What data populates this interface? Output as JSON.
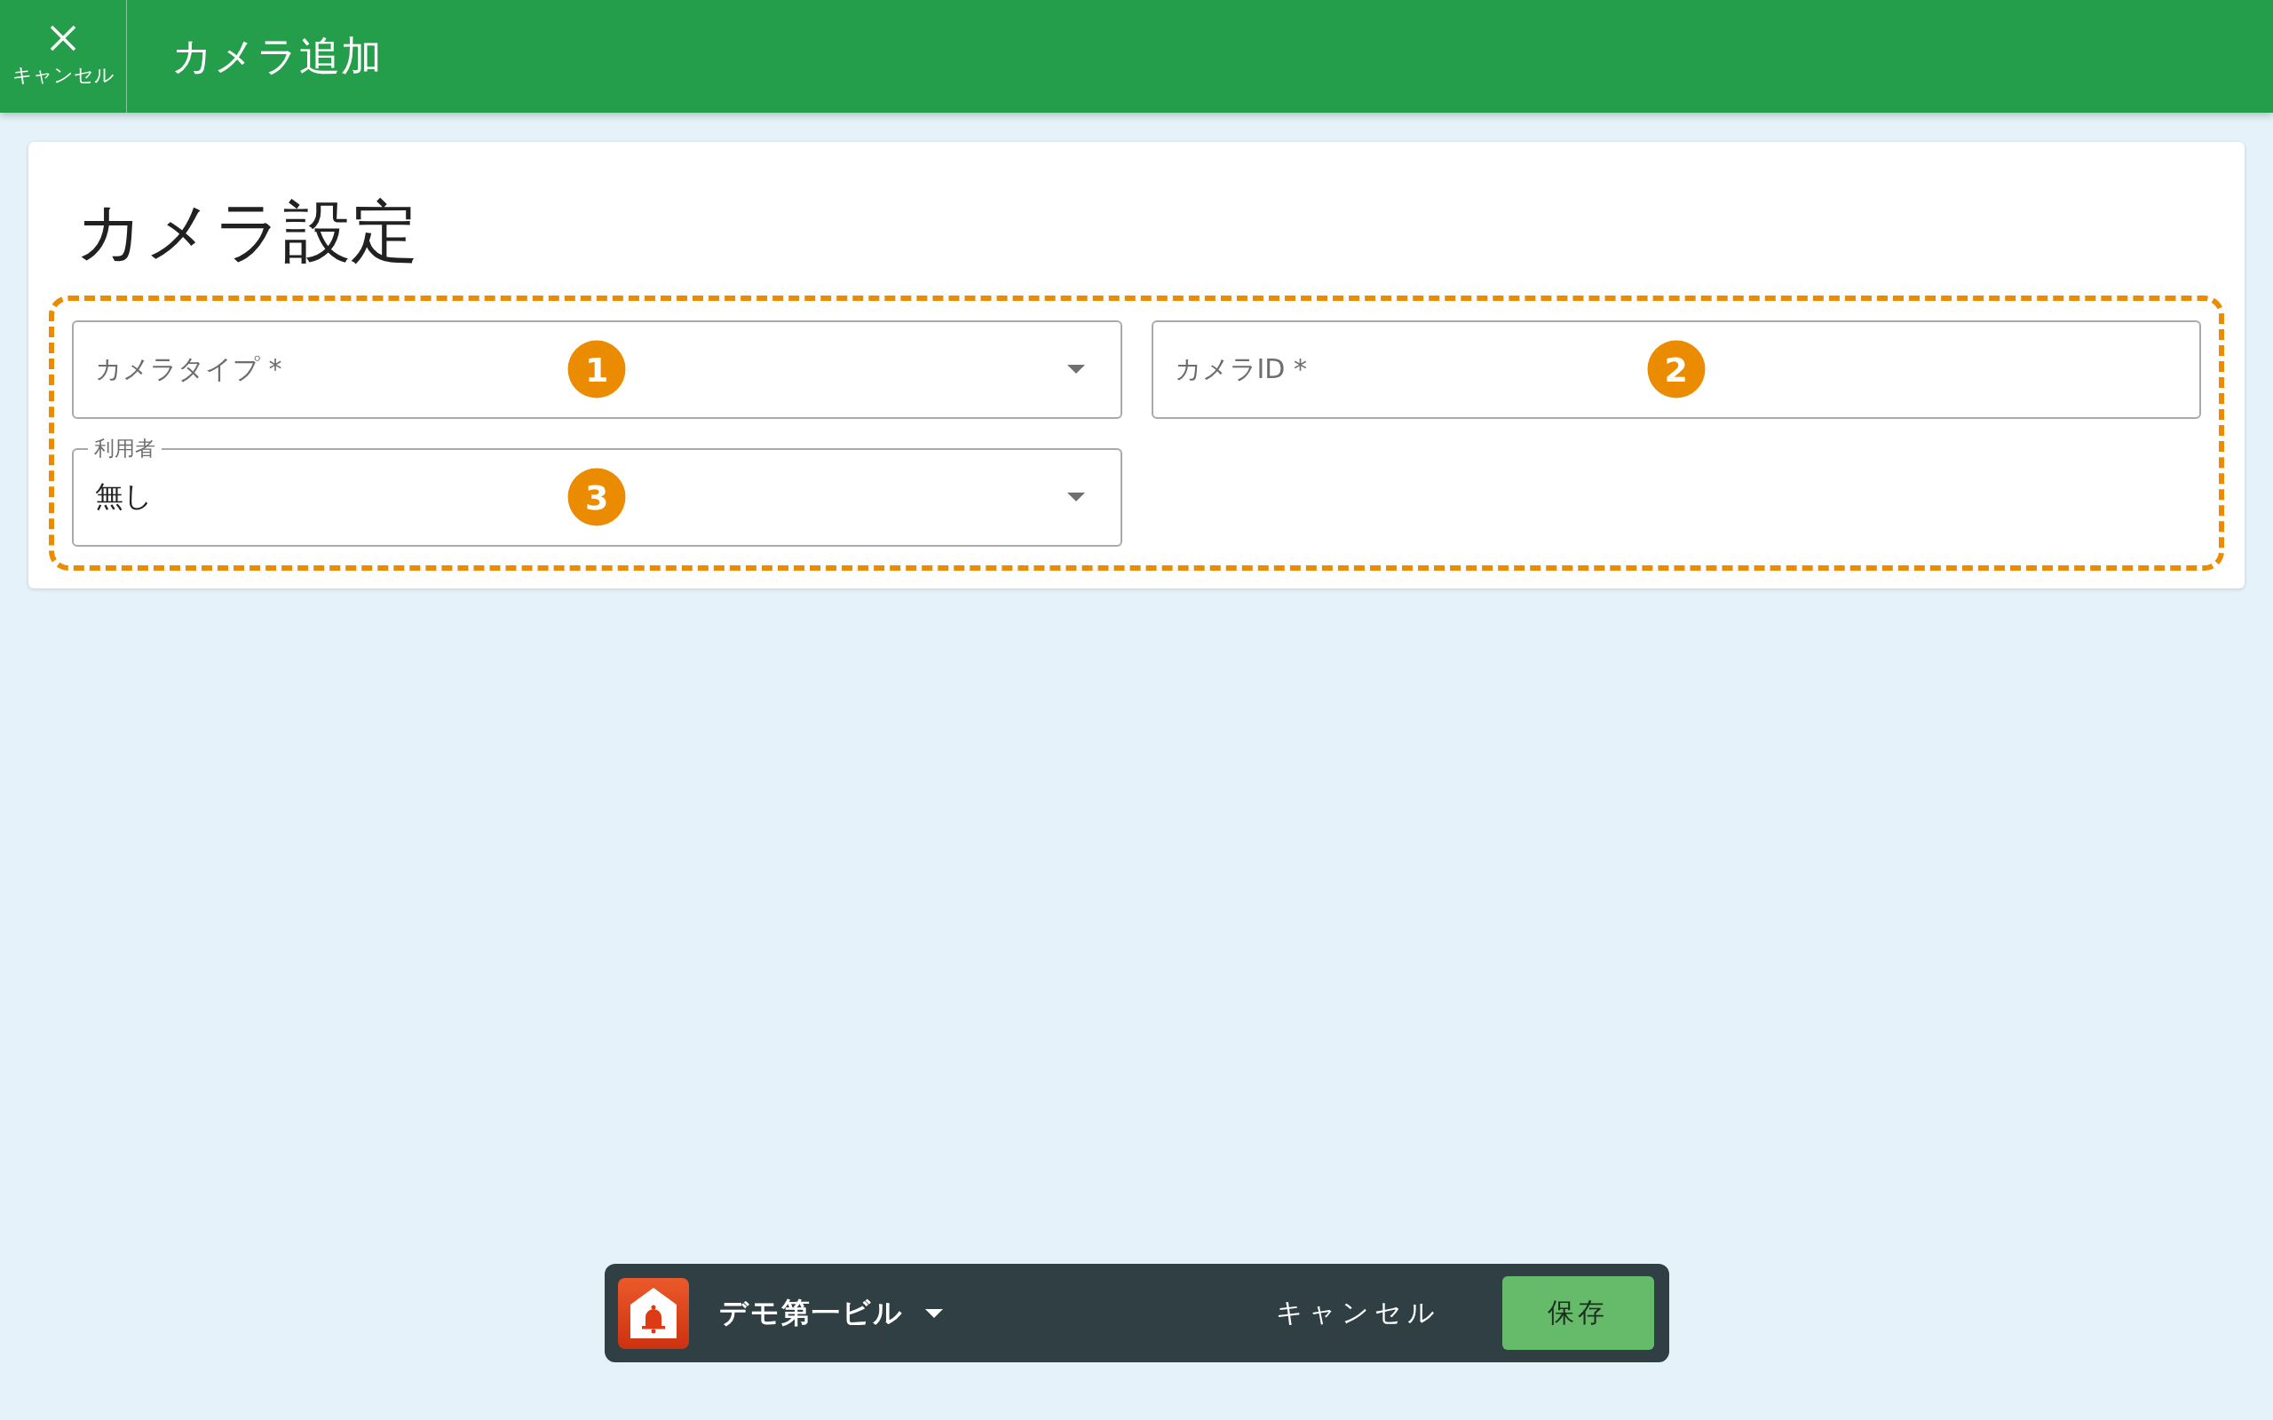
{
  "header": {
    "cancel_label": "キャンセル",
    "title": "カメラ追加"
  },
  "card": {
    "title": "カメラ設定",
    "highlighted": true,
    "fields": [
      {
        "kind": "select",
        "label": "カメラタイプ *",
        "marker": "1"
      },
      {
        "kind": "text",
        "label": "カメラID *",
        "marker": "2"
      },
      {
        "kind": "select",
        "label": "利用者",
        "value": "無し",
        "marker": "3"
      }
    ]
  },
  "bottom_bar": {
    "building": "デモ第一ビル",
    "cancel_label": "キャンセル",
    "save_label": "保存"
  }
}
